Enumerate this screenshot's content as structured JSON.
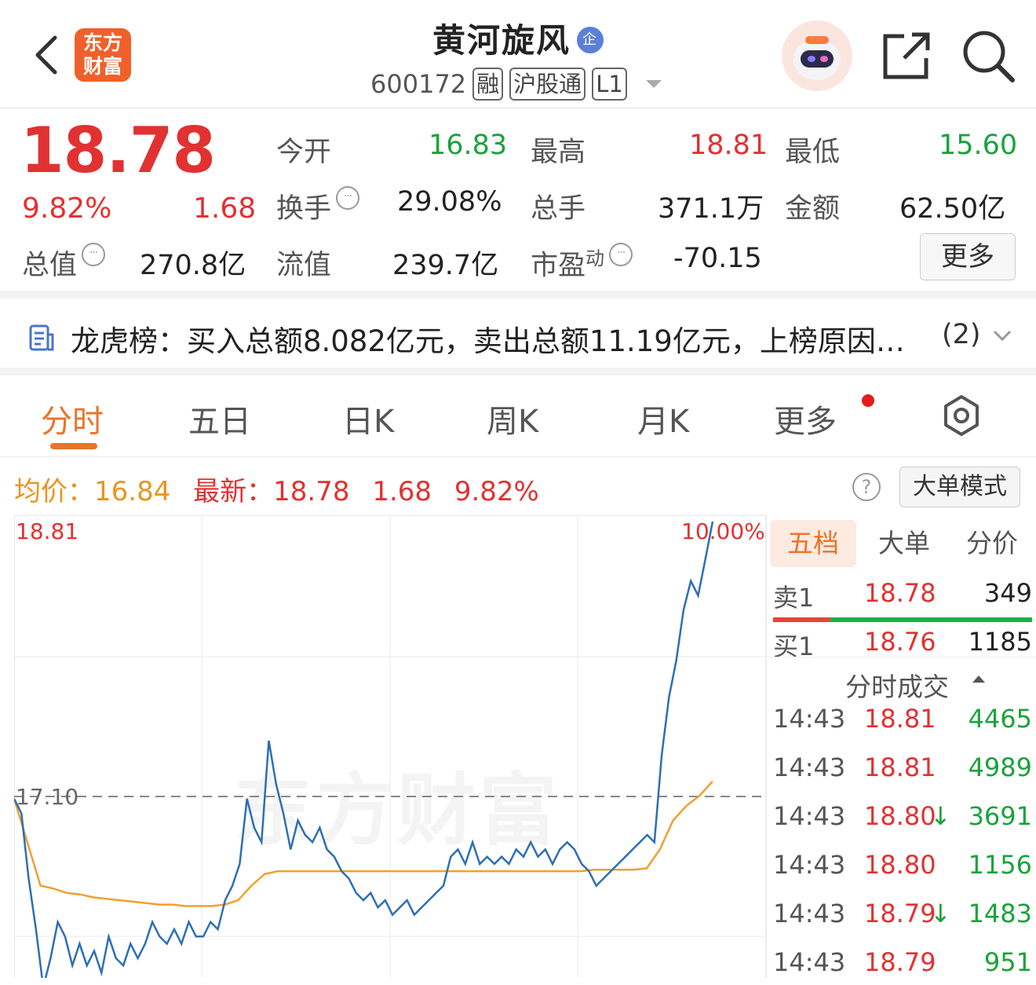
{
  "header": {
    "title": "黄河旋风",
    "badge": "企",
    "code": "600172",
    "tags": [
      "融",
      "沪股通",
      "L1"
    ],
    "logo_line1": "东方",
    "logo_line2": "财富"
  },
  "quote": {
    "price": "18.78",
    "change_pct": "9.82%",
    "change": "1.68",
    "fields": [
      {
        "label": "今开",
        "value": "16.83",
        "color": "green"
      },
      {
        "label": "最高",
        "value": "18.81",
        "color": "red"
      },
      {
        "label": "最低",
        "value": "15.60",
        "color": "green"
      },
      {
        "label": "换手",
        "value": "29.08%",
        "color": "black"
      },
      {
        "label": "总手",
        "value": "371.1万",
        "color": "black"
      },
      {
        "label": "金额",
        "value": "62.50亿",
        "color": "black"
      },
      {
        "label": "总值",
        "value": "270.8亿",
        "color": "black"
      },
      {
        "label": "流值",
        "value": "239.7亿",
        "color": "black"
      },
      {
        "label": "市盈",
        "label_sup": "动",
        "value": "-70.15",
        "color": "black"
      }
    ],
    "more_label": "更多"
  },
  "dragon": {
    "text": "龙虎榜：买入总额8.082亿元，卖出总额11.19亿元，上榜原因…",
    "count": "(2)"
  },
  "tabs": [
    "分时",
    "五日",
    "日K",
    "周K",
    "月K",
    "更多"
  ],
  "info": {
    "avg_label": "均价：",
    "avg_value": "16.84",
    "latest_label": "最新：",
    "latest_value": "18.78",
    "latest_change": "1.68",
    "latest_pct": "9.82%",
    "help": "?",
    "bigorder_label": "大单模式"
  },
  "chart_labels": {
    "max": "18.81",
    "max_pct": "10.00%",
    "prev_close": "17.10",
    "watermark": "东方财富"
  },
  "chart_data": {
    "type": "line",
    "ylim": [
      15.41,
      18.81
    ],
    "prev_close": 17.1,
    "series": [
      {
        "name": "价格",
        "color": "#2d6fb5",
        "values": [
          16.9,
          16.8,
          16.35,
          16.0,
          15.6,
          15.8,
          16.05,
          15.95,
          15.75,
          15.9,
          15.75,
          15.85,
          15.7,
          15.95,
          15.8,
          15.75,
          15.9,
          15.8,
          15.9,
          16.05,
          15.95,
          15.9,
          16.0,
          15.9,
          16.05,
          15.95,
          15.95,
          16.05,
          16.0,
          16.2,
          16.3,
          16.45,
          16.9,
          16.7,
          16.6,
          17.3,
          17.0,
          16.8,
          16.55,
          16.75,
          16.65,
          16.6,
          16.7,
          16.55,
          16.5,
          16.4,
          16.35,
          16.25,
          16.2,
          16.25,
          16.15,
          16.2,
          16.1,
          16.15,
          16.2,
          16.1,
          16.15,
          16.2,
          16.25,
          16.3,
          16.5,
          16.55,
          16.45,
          16.6,
          16.45,
          16.5,
          16.45,
          16.5,
          16.45,
          16.55,
          16.5,
          16.6,
          16.5,
          16.55,
          16.45,
          16.55,
          16.6,
          16.55,
          16.45,
          16.4,
          16.3,
          16.35,
          16.4,
          16.45,
          16.5,
          16.55,
          16.6,
          16.65,
          16.6,
          17.2,
          17.6,
          17.85,
          18.2,
          18.4,
          18.3,
          18.55,
          18.81
        ],
        "x_positions_note": "none"
      },
      {
        "name": "均价",
        "color": "#f0a030",
        "values": [
          16.9,
          16.6,
          16.3,
          16.28,
          16.25,
          16.24,
          16.22,
          16.21,
          16.2,
          16.19,
          16.18,
          16.17,
          16.17,
          16.16,
          16.16,
          16.16,
          16.17,
          16.2,
          16.3,
          16.38,
          16.4,
          16.4,
          16.4,
          16.4,
          16.4,
          16.4,
          16.4,
          16.4,
          16.4,
          16.4,
          16.4,
          16.4,
          16.4,
          16.4,
          16.4,
          16.4,
          16.4,
          16.4,
          16.4,
          16.4,
          16.4,
          16.4,
          16.4,
          16.4,
          16.41,
          16.41,
          16.41,
          16.41,
          16.42,
          16.55,
          16.75,
          16.85,
          16.92,
          17.02
        ]
      }
    ]
  },
  "panel": {
    "tabs": [
      "五档",
      "大单",
      "分价"
    ],
    "sell1": {
      "label": "卖1",
      "price": "18.78",
      "volume": "349"
    },
    "buy1": {
      "label": "买1",
      "price": "18.76",
      "volume": "1185"
    },
    "sell_ratio": 0.22,
    "ticks_title": "分时成交",
    "ticks": [
      {
        "time": "14:43",
        "price": "18.81",
        "arrow": "",
        "volume": "4465"
      },
      {
        "time": "14:43",
        "price": "18.81",
        "arrow": "",
        "volume": "4989"
      },
      {
        "time": "14:43",
        "price": "18.80",
        "arrow": "↓",
        "volume": "3691"
      },
      {
        "time": "14:43",
        "price": "18.80",
        "arrow": "",
        "volume": "1156"
      },
      {
        "time": "14:43",
        "price": "18.79",
        "arrow": "↓",
        "volume": "1483"
      },
      {
        "time": "14:43",
        "price": "18.79",
        "arrow": "",
        "volume": "951"
      }
    ]
  }
}
